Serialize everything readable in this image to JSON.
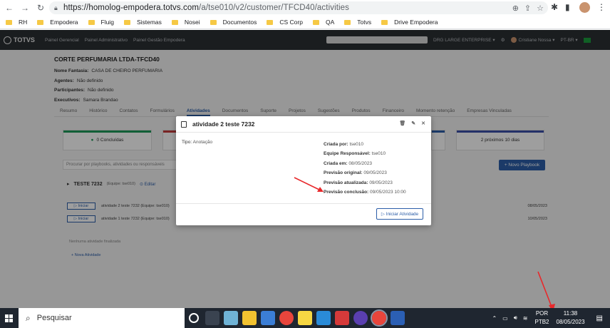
{
  "browser": {
    "url_main": "https://homolog-empodera.totvs.com",
    "url_path": "/a/tse010/v2/customer/TFCD40/activities",
    "bookmarks": [
      "RH",
      "Empodera",
      "Fluig",
      "Sistemas",
      "Nosei",
      "Documentos",
      "CS Corp",
      "QA",
      "Totvs",
      "Drive Empodera"
    ]
  },
  "app": {
    "logo": "TOTVS",
    "nav": [
      "Painel Gerencial",
      "Painel Administrativo",
      "Painel Gestão Empodera"
    ],
    "right": {
      "tenant": "DRG LARGE ENTERPRISE ▾",
      "user": "Cristiane Nossa ▾",
      "lang": "PT-BR ▾"
    }
  },
  "customer": {
    "title": "CORTE PERFUMARIA LTDA-TFCD40",
    "fields": [
      {
        "label": "Nome Fantasia:",
        "value": "CASA DE CHEIRO PERFUMARIA"
      },
      {
        "label": "Agentes:",
        "value": "Não definido"
      },
      {
        "label": "Participantes:",
        "value": "Não definido"
      },
      {
        "label": "Executivos:",
        "value": "Samara Brandao"
      }
    ]
  },
  "tabs": [
    "Resumo",
    "Histórico",
    "Contatos",
    "Formulários",
    "Atividades",
    "Documentos",
    "Suporte",
    "Projetos",
    "Sugestões",
    "Produtos",
    "Financeiro",
    "Momento retenção",
    "Empresas Vinculadas"
  ],
  "cards": {
    "left": "0  Concluídas",
    "right": "2  próximos 10 dias"
  },
  "playbook": {
    "search_placeholder": "Procurar por playbooks, atividades ou responsáveis",
    "new_button": "+ Novo Playbook",
    "section_title": "TESTE 7232",
    "section_team": "(Equipe: tse010)",
    "section_edit": "Editar",
    "activities": [
      {
        "button": "▷ Iniciar",
        "name": "atividade 2 teste 7232 (Equipe: tse010)",
        "date": "08/05/2023"
      },
      {
        "button": "▷ Iniciar",
        "name": "atividade 1 teste 7232 (Equipe: tse010)",
        "date": "10/05/2023"
      }
    ],
    "none_done": "Nenhuma atividade finalizada",
    "new_activity": "+ Nova Atividade"
  },
  "modal": {
    "title": "atividade 2 teste 7232",
    "tipo_label": "Tipo:",
    "tipo_value": "Anotação",
    "info": [
      {
        "label": "Criada por:",
        "value": "tse010"
      },
      {
        "label": "Equipe Responsável:",
        "value": "tse010"
      },
      {
        "label": "Criada em:",
        "value": "08/05/2023"
      },
      {
        "label": "Previsão original:",
        "value": "09/05/2023"
      },
      {
        "label": "Previsão atualizada:",
        "value": "09/05/2023"
      },
      {
        "label": "Previsão conclusão:",
        "value": "09/05/2023 10:00"
      }
    ],
    "start_button": "▷ Iniciar Atividade"
  },
  "taskbar": {
    "search_placeholder": "Pesquisar",
    "lang_line1": "POR",
    "lang_line2": "PTB2",
    "time": "11:38",
    "date": "08/05/2023"
  },
  "colors": {
    "accent": "#2c5ea8",
    "arrow": "#e8282b"
  }
}
